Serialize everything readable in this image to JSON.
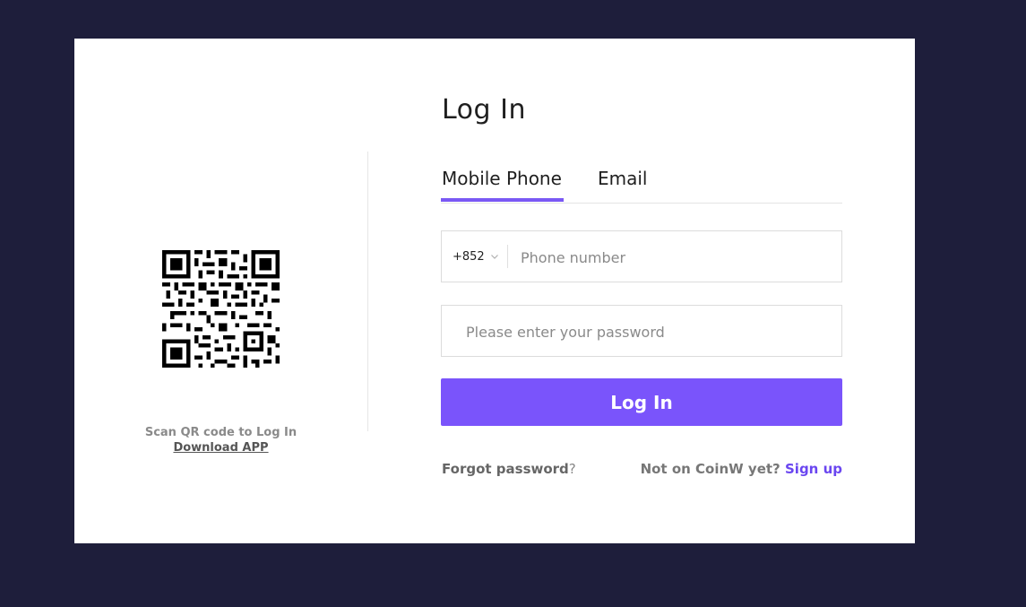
{
  "login": {
    "title": "Log In",
    "tabs": [
      {
        "label": "Mobile Phone",
        "active": true
      },
      {
        "label": "Email",
        "active": false
      }
    ],
    "country_code": "+852",
    "phone_placeholder": "Phone number",
    "password_placeholder": "Please enter your password",
    "submit_label": "Log In",
    "forgot_label": "Forgot password",
    "forgot_suffix": "?",
    "signup_prompt": "Not on CoinW yet?",
    "signup_label": "Sign up"
  },
  "qr_panel": {
    "caption": "Scan QR code to Log In",
    "download_label": "Download APP"
  },
  "colors": {
    "page_background": "#1e1e3b",
    "accent": "#7a54fb",
    "signup_link": "#6a46f0"
  },
  "icons": {
    "qr": "qr-code-icon",
    "dropdown": "chevron-down-icon"
  }
}
